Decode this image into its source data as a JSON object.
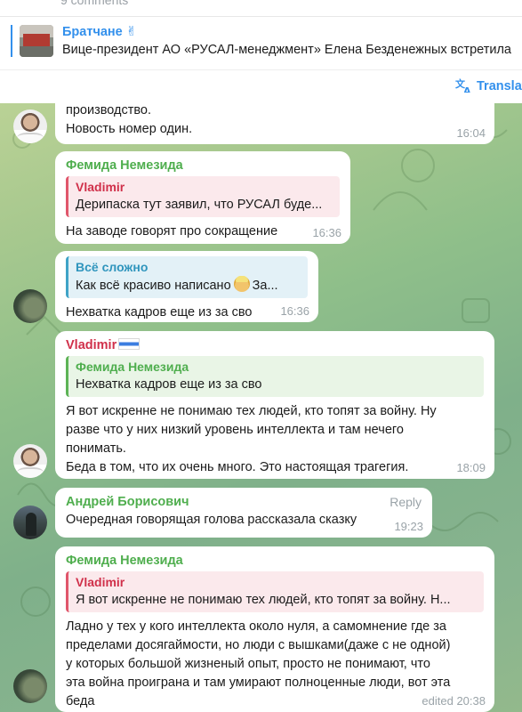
{
  "pinned": {
    "comments_count": "9 comments",
    "channel": "Братчане ✌",
    "preview": "Вице-президент АО «РУСАЛ-менеджмент» Елена Безденежных встретила",
    "translate_label": "Translat"
  },
  "messages": [
    {
      "text_lines": [
        "производство.",
        "Новость номер один."
      ],
      "time": "16:04"
    },
    {
      "sender": "Фемида Немезида",
      "quote_name": "Vladimir",
      "quote_text": "Дерипаска тут заявил, что РУСАЛ буде...",
      "text": "На заводе говорят про сокращение",
      "time": "16:36"
    },
    {
      "quote_name": "Всё сложно",
      "quote_text": "Как всё красиво написано",
      "quote_text_tail": "За...",
      "text": "Нехватка кадров еще из за сво",
      "time": "16:36"
    },
    {
      "sender": "Vladimir",
      "quote_name": "Фемида Немезида",
      "quote_text": "Нехватка кадров еще из за сво",
      "text_lines": [
        "Я вот искренне не понимаю тех людей, кто топят за войну. Ну",
        "разве что у них низкий уровень интеллекта и там нечего",
        "понимать.",
        "Беда в том, что их очень много. Это настоящая трагегия."
      ],
      "time": "18:09"
    },
    {
      "sender": "Андрей Борисович",
      "reply_label": "Reply",
      "text": "Очередная говорящая голова рассказала сказку",
      "time": "19:23"
    },
    {
      "sender": "Фемида Немезида",
      "quote_name": "Vladimir",
      "quote_text": "Я вот искренне не понимаю тех людей, кто топят за войну. Н...",
      "text_lines": [
        "Ладно у тех у кого интеллекта около нуля, а самомнение где за",
        "пределами досягаймости, но люди с вышками(даже с не одной)",
        "у которых большой жизненый опыт, просто не понимают, что",
        "эта война проиграна и там умирают полноценные люди, вот эта",
        "беда"
      ],
      "time": "edited 20:38"
    }
  ],
  "icons": {
    "translate": "translate-icon",
    "flag": "flag-icon",
    "emoji": "construction-worker-emoji-icon"
  },
  "colors": {
    "accent": "#3390ec",
    "sender_green": "#4fae4e",
    "sender_red": "#d0304a",
    "time": "#9aa3a8"
  }
}
